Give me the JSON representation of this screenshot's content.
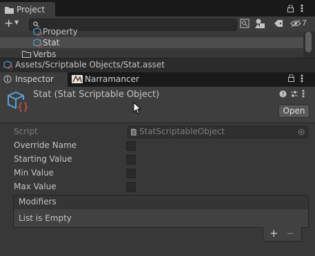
{
  "project_panel": {
    "tab_label": "Project",
    "search": {
      "placeholder": ""
    },
    "hidden_count": "7",
    "tree": {
      "items": [
        {
          "label": "Property"
        },
        {
          "label": "Stat"
        },
        {
          "label": "Verbs"
        }
      ],
      "selected_index": 1
    },
    "path": "Assets/Scriptable Objects/Stat.asset"
  },
  "inspector": {
    "tabs": [
      {
        "label": "Inspector"
      },
      {
        "label": "Narramancer"
      }
    ],
    "header": {
      "title": "Stat (Stat Scriptable Object)",
      "open_label": "Open"
    },
    "fields": {
      "script_label": "Script",
      "script_value": "StatScriptableObject",
      "override_name": "Override Name",
      "starting_value": "Starting Value",
      "min_value": "Min Value",
      "max_value": "Max Value"
    },
    "modifiers": {
      "title": "Modifiers",
      "empty_text": "List is Empty",
      "add_label": "+",
      "remove_label": "−"
    }
  }
}
